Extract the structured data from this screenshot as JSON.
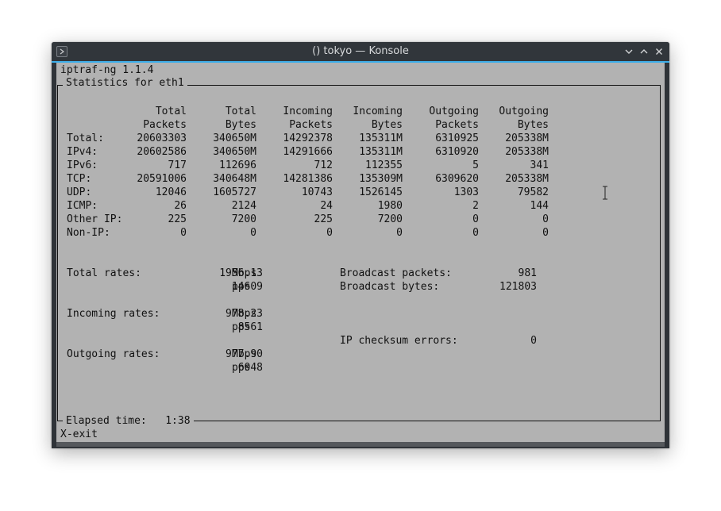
{
  "window": {
    "title": "() tokyo — Konsole"
  },
  "terminal": {
    "header": "iptraf-ng 1.1.4",
    "frame_title": "Statistics for eth1",
    "table": {
      "headers": [
        [
          "Total",
          "Packets"
        ],
        [
          "Total",
          "Bytes"
        ],
        [
          "Incoming",
          "Packets"
        ],
        [
          "Incoming",
          "Bytes"
        ],
        [
          "Outgoing",
          "Packets"
        ],
        [
          "Outgoing",
          "Bytes"
        ]
      ],
      "rows": [
        {
          "label": "Total:",
          "values": [
            "20603303",
            "340650M",
            "14292378",
            "135311M",
            "6310925",
            "205338M"
          ]
        },
        {
          "label": "IPv4:",
          "values": [
            "20602586",
            "340650M",
            "14291666",
            "135311M",
            "6310920",
            "205338M"
          ]
        },
        {
          "label": "IPv6:",
          "values": [
            "717",
            "112696",
            "712",
            "112355",
            "5",
            "341"
          ]
        },
        {
          "label": "TCP:",
          "values": [
            "20591006",
            "340648M",
            "14281386",
            "135309M",
            "6309620",
            "205338M"
          ]
        },
        {
          "label": "UDP:",
          "values": [
            "12046",
            "1605727",
            "10743",
            "1526145",
            "1303",
            "79582"
          ]
        },
        {
          "label": "ICMP:",
          "values": [
            "26",
            "2124",
            "24",
            "1980",
            "2",
            "144"
          ]
        },
        {
          "label": "Other IP:",
          "values": [
            "225",
            "7200",
            "225",
            "7200",
            "0",
            "0"
          ]
        },
        {
          "label": "Non-IP:",
          "values": [
            "0",
            "0",
            "0",
            "0",
            "0",
            "0"
          ]
        }
      ]
    },
    "rates": {
      "total": {
        "label": "Total rates:",
        "bps": "1956.13",
        "bps_unit": "Mbps",
        "pps": "14609",
        "pps_unit": "pps"
      },
      "incoming": {
        "label": "Incoming rates:",
        "bps": "978.23",
        "bps_unit": "Mbps",
        "pps": "8561",
        "pps_unit": "pps"
      },
      "outgoing": {
        "label": "Outgoing rates:",
        "bps": "977.90",
        "bps_unit": "Mbps",
        "pps": "6048",
        "pps_unit": "pps"
      }
    },
    "broadcast": {
      "packets_label": "Broadcast packets:",
      "packets": "981",
      "bytes_label": "Broadcast bytes:",
      "bytes": "121803"
    },
    "checksum": {
      "label": "IP checksum errors:",
      "value": "0"
    },
    "elapsed": {
      "label": "Elapsed time:",
      "value": "1:38"
    },
    "footer_hint": "X-exit"
  }
}
